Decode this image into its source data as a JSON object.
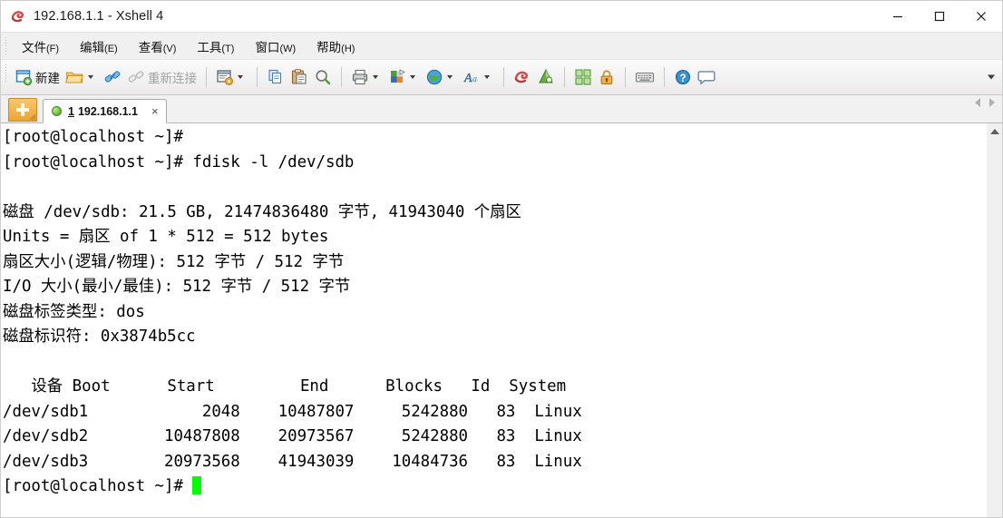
{
  "window": {
    "title": "192.168.1.1 - Xshell 4",
    "app_icon": "xshell-logo-icon",
    "minimize_label": "—",
    "maximize_label": "□",
    "close_label": "✕"
  },
  "menubar": {
    "items": [
      {
        "label": "文件",
        "mnemonic": "(F)",
        "name": "menu-file"
      },
      {
        "label": "编辑",
        "mnemonic": "(E)",
        "name": "menu-edit"
      },
      {
        "label": "查看",
        "mnemonic": "(V)",
        "name": "menu-view"
      },
      {
        "label": "工具",
        "mnemonic": "(T)",
        "name": "menu-tools"
      },
      {
        "label": "窗口",
        "mnemonic": "(W)",
        "name": "menu-window"
      },
      {
        "label": "帮助",
        "mnemonic": "(H)",
        "name": "menu-help"
      }
    ]
  },
  "toolbar": {
    "new_label": "新建",
    "reconnect_label": "重新连接",
    "overflow_label": "toolbar-overflow"
  },
  "tabbar": {
    "new_tab_label": "+",
    "tabs": [
      {
        "index": "1",
        "title": "192.168.1.1",
        "close_label": "×",
        "status": "connected"
      }
    ]
  },
  "terminal": {
    "cursor_color": "#00ff00",
    "foreground": "#000000",
    "background": "#ffffff",
    "lines": [
      "[root@localhost ~]#",
      "[root@localhost ~]# fdisk -l /dev/sdb",
      "",
      "磁盘 /dev/sdb: 21.5 GB, 21474836480 字节, 41943040 个扇区",
      "Units = 扇区 of 1 * 512 = 512 bytes",
      "扇区大小(逻辑/物理): 512 字节 / 512 字节",
      "I/O 大小(最小/最佳): 512 字节 / 512 字节",
      "磁盘标签类型: dos",
      "磁盘标识符: 0x3874b5cc",
      "",
      "   设备 Boot      Start         End      Blocks   Id  System",
      "/dev/sdb1            2048    10487807     5242880   83  Linux",
      "/dev/sdb2        10487808    20973567     5242880   83  Linux",
      "/dev/sdb3        20973568    41943039    10484736   83  Linux"
    ],
    "prompt_last": "[root@localhost ~]# ",
    "command": "fdisk -l /dev/sdb",
    "disk_info": {
      "device": "/dev/sdb",
      "size_human": "21.5 GB",
      "size_bytes": "21474836480",
      "sectors": "41943040",
      "units": "扇区 of 1 * 512 = 512 bytes",
      "sector_size_logical": "512",
      "sector_size_physical": "512",
      "io_size_min": "512",
      "io_size_optimal": "512",
      "label_type": "dos",
      "identifier": "0x3874b5cc"
    },
    "partition_table": {
      "headers": [
        "设备",
        "Boot",
        "Start",
        "End",
        "Blocks",
        "Id",
        "System"
      ],
      "rows": [
        [
          "/dev/sdb1",
          "",
          "2048",
          "10487807",
          "5242880",
          "83",
          "Linux"
        ],
        [
          "/dev/sdb2",
          "",
          "10487808",
          "20973567",
          "5242880",
          "83",
          "Linux"
        ],
        [
          "/dev/sdb3",
          "",
          "20973568",
          "41943039",
          "10484736",
          "83",
          "Linux"
        ]
      ]
    }
  }
}
